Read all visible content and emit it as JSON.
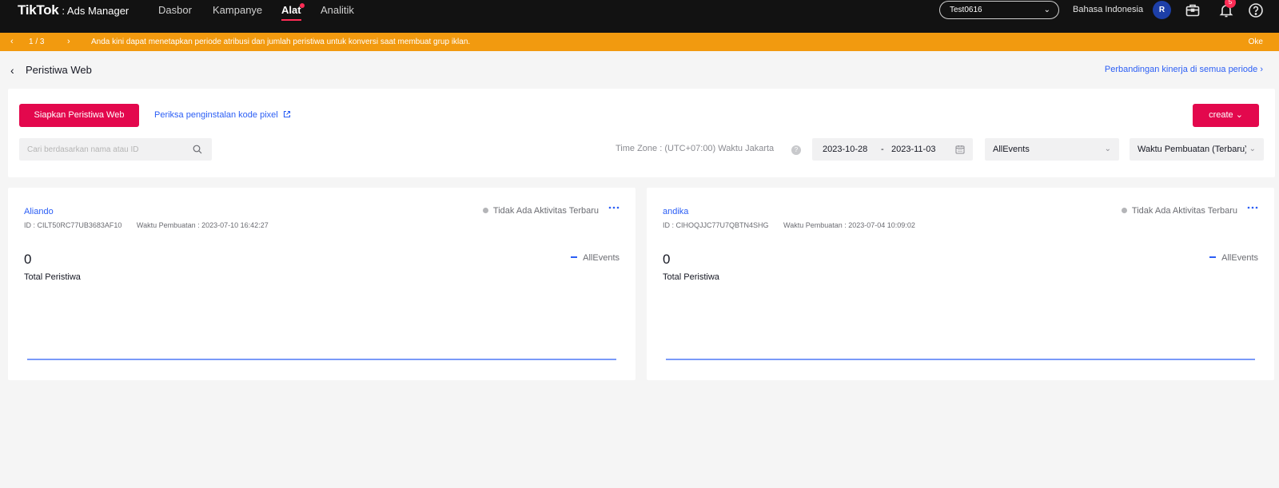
{
  "app": {
    "logo_main": "TikTok",
    "logo_sub": ": Ads Manager"
  },
  "nav": {
    "items": [
      {
        "label": "Dasbor"
      },
      {
        "label": "Kampanye"
      },
      {
        "label": "Alat",
        "active": true
      },
      {
        "label": "Analitik"
      }
    ],
    "account": "Test0616",
    "language": "Bahasa Indonesia",
    "avatar_initial": "R",
    "notification_count": "5",
    "icons": [
      "briefcase-icon",
      "bell-icon",
      "help-circle-icon"
    ]
  },
  "announcement": {
    "page": "1 / 3",
    "message": "Anda kini dapat menetapkan periode atribusi dan jumlah peristiwa untuk konversi saat membuat grup iklan.",
    "ok_label": "Oke",
    "color": "#f29a0f"
  },
  "page": {
    "title": "Peristiwa Web",
    "compare_link": "Perbandingan kinerja di semua periode"
  },
  "toolbar": {
    "setup_button": "Siapkan Peristiwa Web",
    "check_link": "Periksa penginstalan kode pixel",
    "create_button": "create",
    "search_placeholder": "Cari berdasarkan nama atau ID",
    "timezone": "Time Zone : (UTC+07:00) Waktu Jakarta",
    "date_start": "2023-10-28",
    "date_sep": "-",
    "date_end": "2023-11-03",
    "events_select": "AllEvents",
    "sort_select": "Waktu Pembuatan (Terbaru)"
  },
  "pixels": [
    {
      "name": "Aliando",
      "id": "ID : CILT50RC77UB3683AF10",
      "created": "Waktu Pembuatan : 2023-07-10 16:42:27",
      "status": "Tidak Ada Aktivitas Terbaru",
      "total": "0",
      "total_label": "Total Peristiwa",
      "legend": "AllEvents"
    },
    {
      "name": "andika",
      "id": "ID : CIHOQJJC77U7QBTN4SHG",
      "created": "Waktu Pembuatan : 2023-07-04 10:09:02",
      "status": "Tidak Ada Aktivitas Terbaru",
      "total": "0",
      "total_label": "Total Peristiwa",
      "legend": "AllEvents"
    }
  ],
  "colors": {
    "brand": "#e3084d",
    "link": "#2b5ef5",
    "nav_bg": "#121212"
  }
}
